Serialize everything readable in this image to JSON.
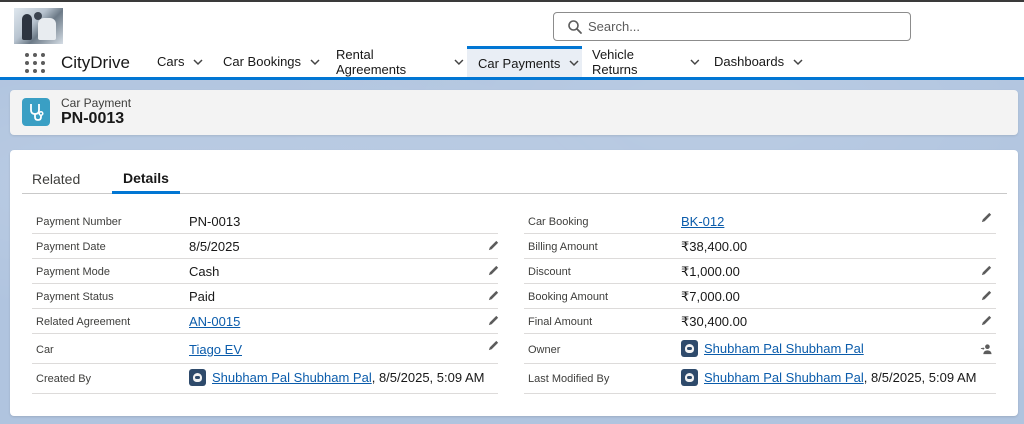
{
  "header": {
    "search_placeholder": "Search..."
  },
  "nav": {
    "app_name": "CityDrive",
    "tabs": [
      {
        "label": "Cars"
      },
      {
        "label": "Car Bookings"
      },
      {
        "label": "Rental Agreements"
      },
      {
        "label": "Car Payments"
      },
      {
        "label": "Vehicle Returns"
      },
      {
        "label": "Dashboards"
      }
    ],
    "active_tab": "Car Payments"
  },
  "record": {
    "type": "Car Payment",
    "name": "PN-0013"
  },
  "detail_tabs": [
    {
      "label": "Related"
    },
    {
      "label": "Details"
    }
  ],
  "left_fields": [
    {
      "label": "Payment Number",
      "value": "PN-0013"
    },
    {
      "label": "Payment Date",
      "value": "8/5/2025"
    },
    {
      "label": "Payment Mode",
      "value": "Cash"
    },
    {
      "label": "Payment Status",
      "value": "Paid"
    },
    {
      "label": "Related Agreement",
      "value": "AN-0015"
    },
    {
      "label": "Car",
      "value": "Tiago EV"
    },
    {
      "label": "Created By",
      "value": "Shubham Pal Shubham Pal",
      "suffix": ", 8/5/2025, 5:09 AM"
    }
  ],
  "right_fields": [
    {
      "label": "Car Booking",
      "value": "BK-012"
    },
    {
      "label": "Billing Amount",
      "value": "₹38,400.00"
    },
    {
      "label": "Discount",
      "value": "₹1,000.00"
    },
    {
      "label": "Booking Amount",
      "value": "₹7,000.00"
    },
    {
      "label": "Final Amount",
      "value": "₹30,400.00"
    },
    {
      "label": "Owner",
      "value": "Shubham Pal Shubham Pal"
    },
    {
      "label": "Last Modified By",
      "value": "Shubham Pal Shubham Pal",
      "suffix": ", 8/5/2025, 5:09 AM"
    }
  ],
  "colors": {
    "brand_blue": "#0176d3",
    "link": "#0b5cab",
    "record_icon": "#3a9fc4",
    "background": "#b0c4df"
  }
}
